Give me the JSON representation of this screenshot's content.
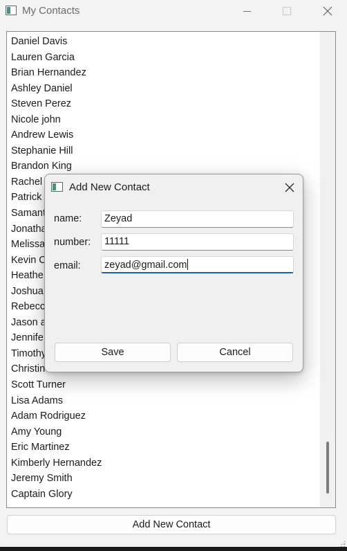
{
  "window": {
    "title": "My Contacts",
    "icons": {
      "app": "app-window-icon",
      "minimize": "minimize-icon",
      "maximize": "maximize-icon",
      "close": "close-icon"
    }
  },
  "contacts": [
    "Daniel Davis",
    "Lauren Garcia",
    "Brian Hernandez",
    "Ashley Daniel",
    "Steven Perez",
    "Nicole john",
    "Andrew Lewis",
    "Stephanie Hill",
    "Brandon King",
    "Rachel",
    "Patrick",
    "Samant",
    "Jonatha",
    "Melissa",
    "Kevin C",
    "Heathe",
    "Joshua",
    "Rebecc",
    "Jason a",
    "Jennife",
    "Timothy",
    "Christin",
    "Scott Turner",
    "Lisa Adams",
    "Adam Rodriguez",
    "Amy Young",
    "Eric Martinez",
    "Kimberly Hernandez",
    "Jeremy Smith",
    "Captain Glory"
  ],
  "main": {
    "add_button_label": "Add New Contact"
  },
  "dialog": {
    "title": "Add New Contact",
    "fields": {
      "name_label": "name:",
      "name_value": "Zeyad",
      "number_label": "number:",
      "number_value": "11111",
      "email_label": "email:",
      "email_value": "zeyad@gmail.com"
    },
    "save_label": "Save",
    "cancel_label": "Cancel"
  },
  "colors": {
    "accent": "#1a5fa8",
    "window_bg": "#f3f3f3",
    "list_bg": "#ffffff"
  }
}
